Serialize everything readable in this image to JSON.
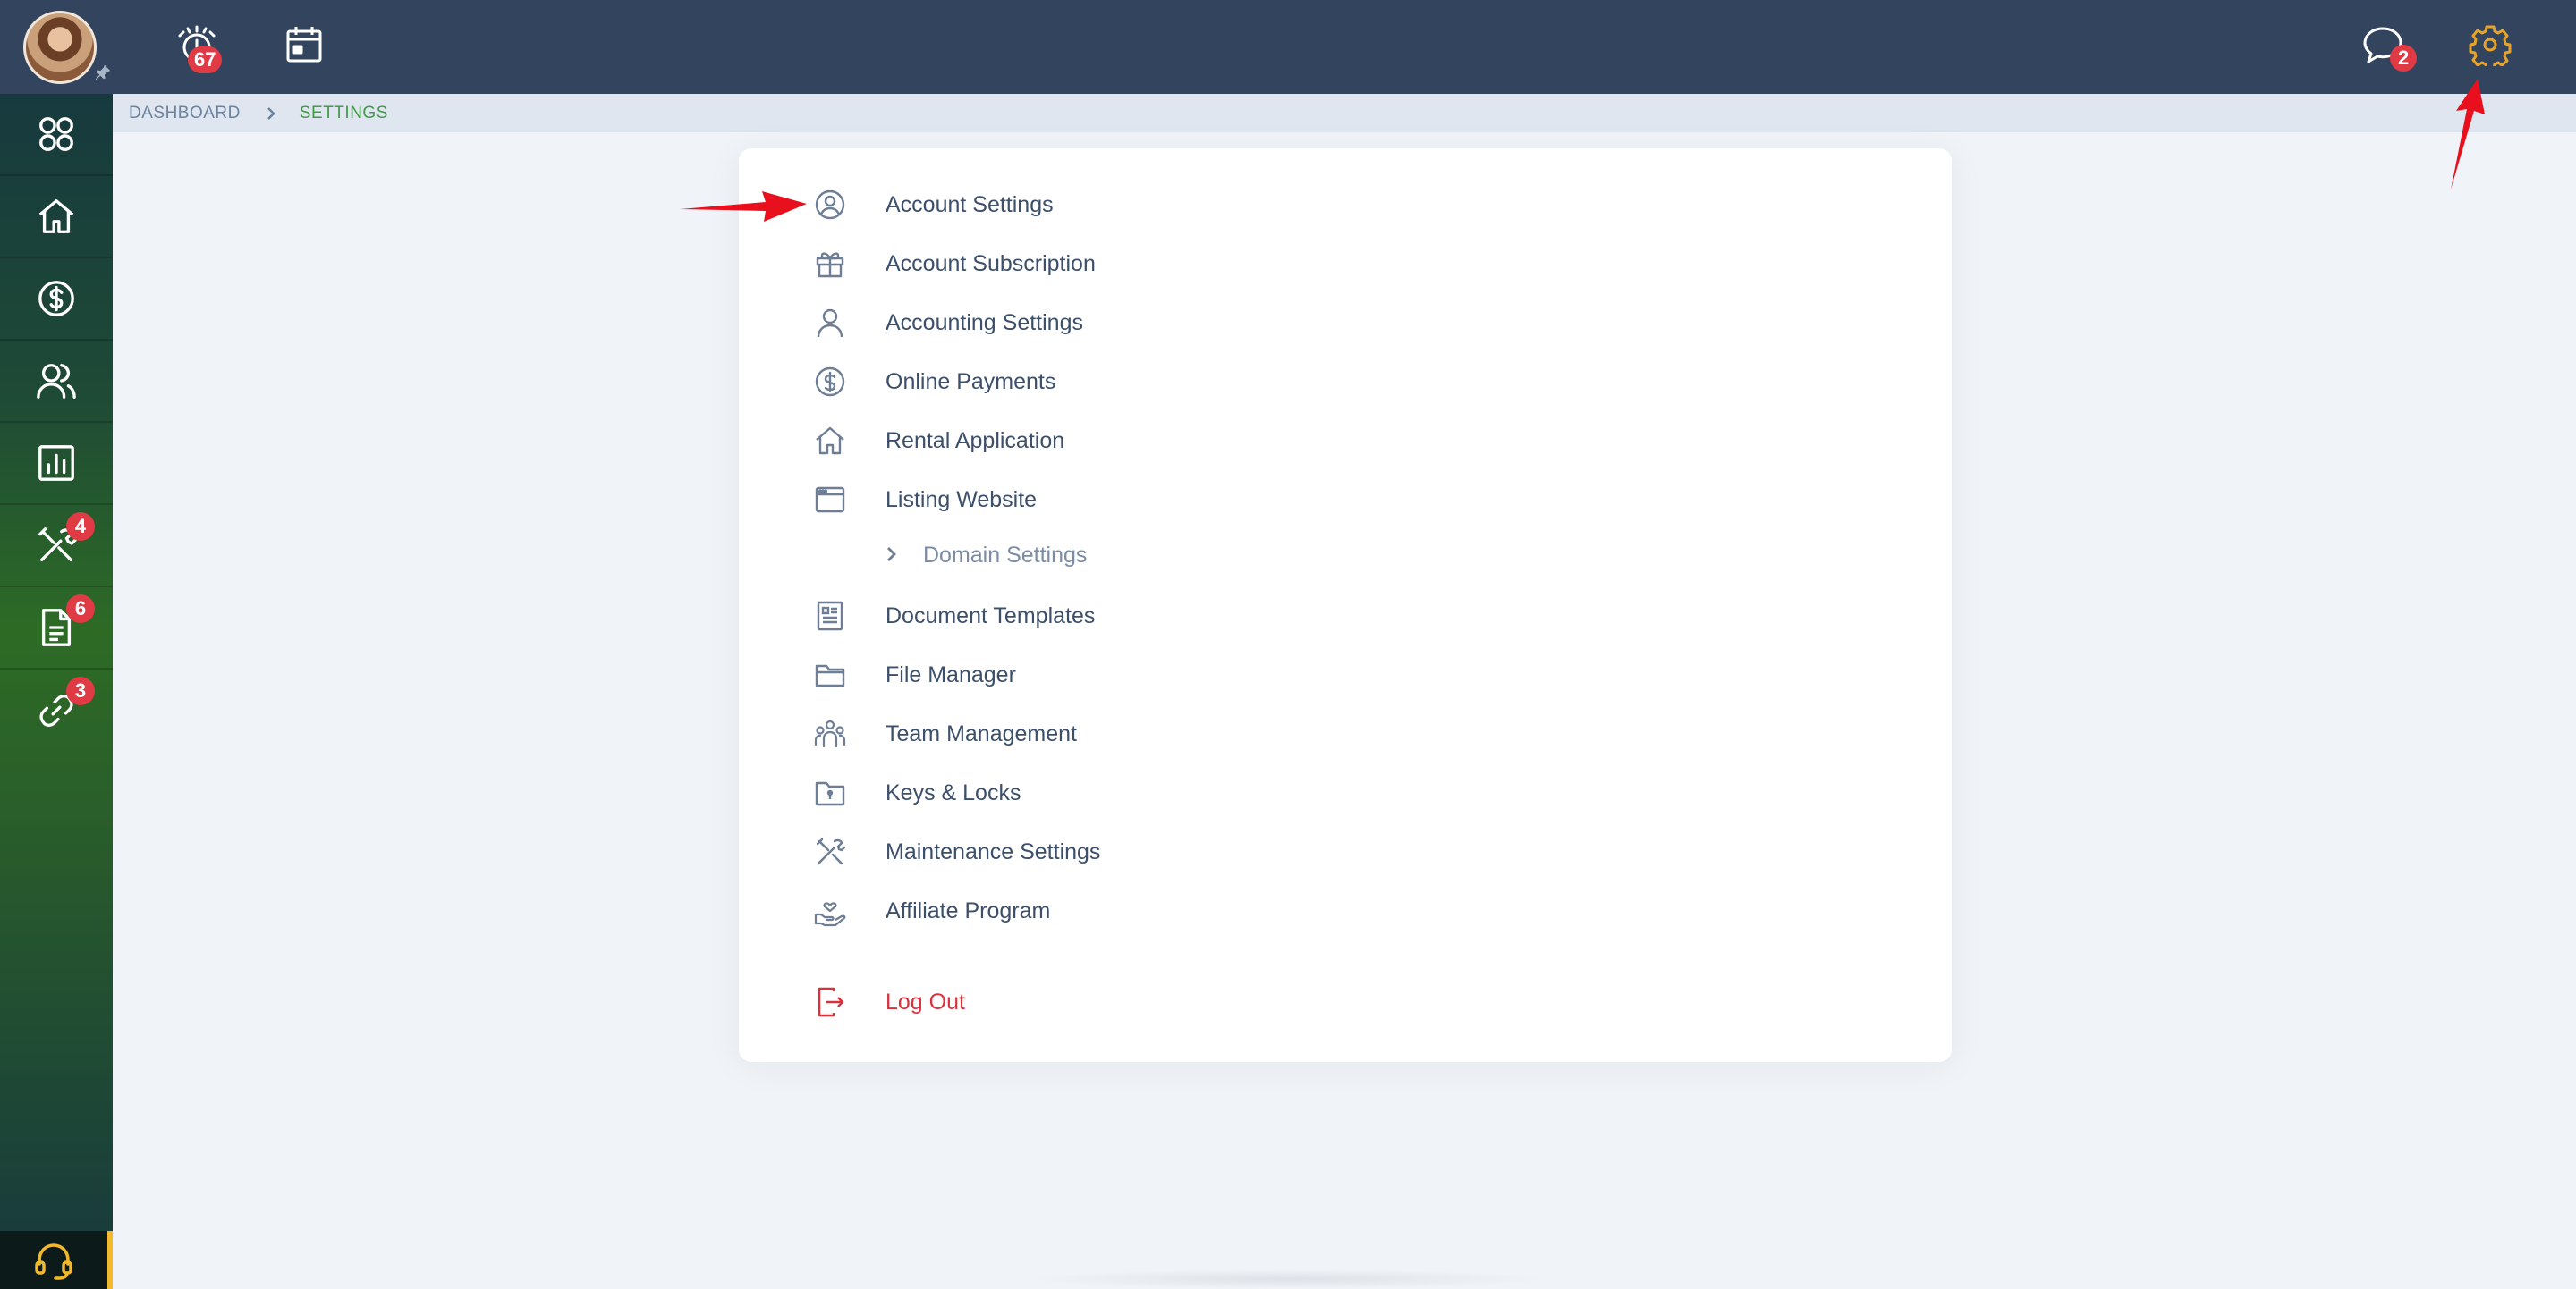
{
  "topbar": {
    "alerts_badge": "67",
    "messages_badge": "2"
  },
  "sidebar": {
    "items": [
      {
        "name": "apps"
      },
      {
        "name": "home"
      },
      {
        "name": "payments"
      },
      {
        "name": "people"
      },
      {
        "name": "reports"
      },
      {
        "name": "maintenance",
        "badge": "4"
      },
      {
        "name": "documents",
        "badge": "6"
      },
      {
        "name": "links",
        "badge": "3"
      }
    ]
  },
  "breadcrumb": {
    "home": "DASHBOARD",
    "current": "SETTINGS"
  },
  "menu": {
    "items": [
      {
        "label": "Account Settings",
        "icon": "user-circle-icon"
      },
      {
        "label": "Account Subscription",
        "icon": "gift-icon"
      },
      {
        "label": "Accounting Settings",
        "icon": "user-icon"
      },
      {
        "label": "Online Payments",
        "icon": "dollar-circle-icon"
      },
      {
        "label": "Rental Application",
        "icon": "home-icon"
      },
      {
        "label": "Listing Website",
        "icon": "browser-window-icon"
      },
      {
        "label": "Domain Settings",
        "icon": "chevron-right-icon"
      },
      {
        "label": "Document Templates",
        "icon": "document-template-icon"
      },
      {
        "label": "File Manager",
        "icon": "folder-icon"
      },
      {
        "label": "Team Management",
        "icon": "team-icon"
      },
      {
        "label": "Keys & Locks",
        "icon": "key-lock-icon"
      },
      {
        "label": "Maintenance Settings",
        "icon": "tools-icon"
      },
      {
        "label": "Affiliate Program",
        "icon": "hand-heart-icon"
      },
      {
        "label": "Log Out",
        "icon": "logout-icon"
      }
    ]
  },
  "colors": {
    "topbar": "#33455e",
    "accent_green": "#3f9b46",
    "badge_red": "#e03a45",
    "gear_orange": "#e8a32a",
    "logout_red": "#d9323d"
  }
}
